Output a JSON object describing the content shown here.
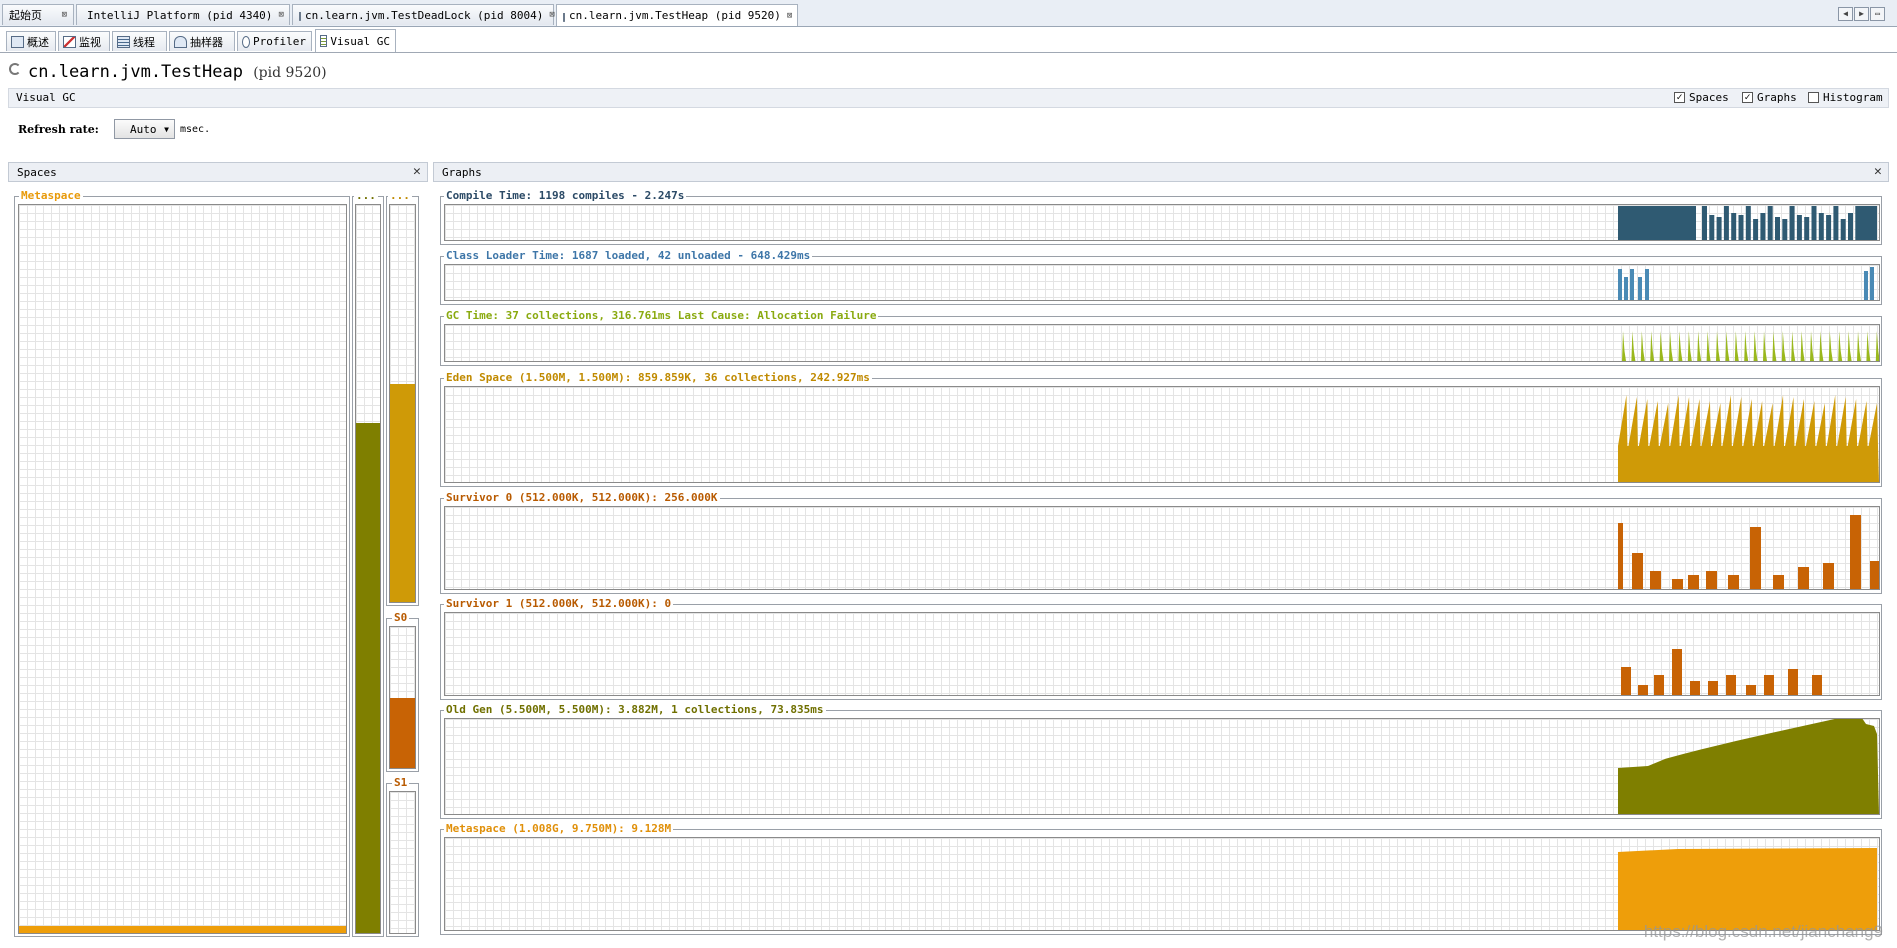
{
  "doc_tabs": [
    {
      "label": "起始页",
      "icon": "none"
    },
    {
      "label": "IntelliJ Platform (pid 4340)",
      "icon": "intellij-icon"
    },
    {
      "label": "cn.learn.jvm.TestDeadLock (pid 8004)",
      "icon": "java-cup-icon"
    },
    {
      "label": "cn.learn.jvm.TestHeap (pid 9520)",
      "icon": "java-cup-icon"
    }
  ],
  "view_tabs": [
    {
      "label": "概述"
    },
    {
      "label": "监视"
    },
    {
      "label": "线程"
    },
    {
      "label": "抽样器"
    },
    {
      "label": "Profiler"
    },
    {
      "label": "Visual GC"
    }
  ],
  "header": {
    "app_name": "cn.learn.jvm.TestHeap",
    "pid": "(pid 9520)"
  },
  "visual_gc_label": "Visual GC",
  "options": {
    "spaces": {
      "label": "Spaces",
      "checked": true
    },
    "graphs": {
      "label": "Graphs",
      "checked": true
    },
    "histogram": {
      "label": "Histogram",
      "checked": false
    }
  },
  "refresh": {
    "label": "Refresh rate:",
    "value": "Auto",
    "unit": "msec."
  },
  "spaces_panel": {
    "title": "Spaces",
    "metaspace_label": "Metaspace",
    "metaspace_fill": 0.01,
    "old_label": "...",
    "old_fill": 0.7,
    "eden_label": "...",
    "eden_fill": 0.55,
    "s0_label": "S0",
    "s0_fill": 0.5,
    "s1_label": "S1",
    "s1_fill": 0.0
  },
  "graphs_panel": {
    "title": "Graphs",
    "graphs": [
      {
        "key": "compile",
        "label": "Compile Time: 1198 compiles - 2.247s",
        "color": "#2f5a72",
        "label_color": "#2b4a66"
      },
      {
        "key": "classloader",
        "label": "Class Loader Time: 1687 loaded, 42 unloaded - 648.429ms",
        "color": "#4a8ab5",
        "label_color": "#3e76a8"
      },
      {
        "key": "gc",
        "label": "GC Time: 37 collections, 316.761ms Last Cause: Allocation Failure",
        "color": "#9ab81c",
        "label_color": "#8aaa10"
      },
      {
        "key": "eden",
        "label": "Eden Space (1.500M, 1.500M): 859.859K, 36 collections, 242.927ms",
        "color": "#cf9a07",
        "label_color": "#c08a00"
      },
      {
        "key": "s0",
        "label": "Survivor 0 (512.000K, 512.000K): 256.000K",
        "color": "#c86305",
        "label_color": "#b85a00"
      },
      {
        "key": "s1",
        "label": "Survivor 1 (512.000K, 512.000K): 0",
        "color": "#c86305",
        "label_color": "#b85a00"
      },
      {
        "key": "old",
        "label": "Old Gen (5.500M, 5.500M): 3.882M, 1 collections, 73.835ms",
        "color": "#7f7f00",
        "label_color": "#707000"
      },
      {
        "key": "meta",
        "label": "Metaspace (1.008G, 9.750M): 9.128M",
        "color": "#ee9e0a",
        "label_color": "#e0900a"
      }
    ]
  },
  "watermark": "https://blog.csdn.net/jianchang9"
}
